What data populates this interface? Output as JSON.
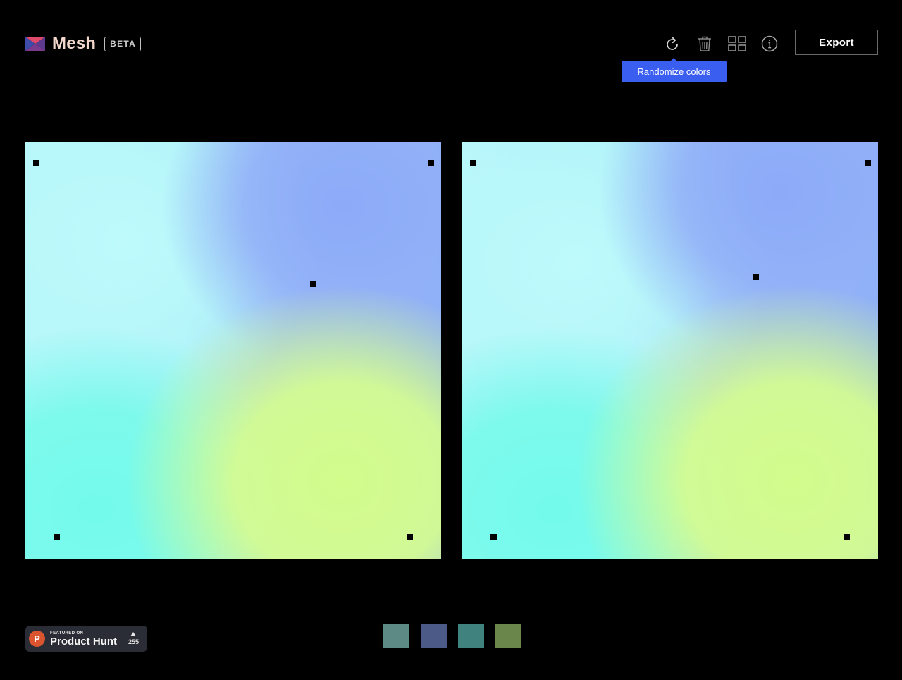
{
  "header": {
    "app_name": "Mesh",
    "badge": "BETA",
    "logo_icon": "mesh-logo-icon",
    "toolbar": [
      {
        "name": "randomize-button",
        "icon": "refresh-icon"
      },
      {
        "name": "delete-button",
        "icon": "trash-icon"
      },
      {
        "name": "grid-button",
        "icon": "grid-icon"
      },
      {
        "name": "info-button",
        "icon": "info-icon"
      }
    ],
    "tooltip": "Randomize colors",
    "export_label": "Export"
  },
  "canvases": [
    {
      "name": "left-gradient-canvas"
    },
    {
      "name": "right-gradient-canvas"
    }
  ],
  "footer": {
    "producthunt": {
      "featured": "FEATURED ON",
      "name": "Product Hunt",
      "logo_letter": "P",
      "votes": "255"
    },
    "swatch_colors": [
      "#5e8a86",
      "#4b5a86",
      "#40827e",
      "#6a864a"
    ]
  },
  "colors": {
    "accent": "#3a5ef0",
    "background": "#000000",
    "producthunt_brand": "#da552f"
  }
}
